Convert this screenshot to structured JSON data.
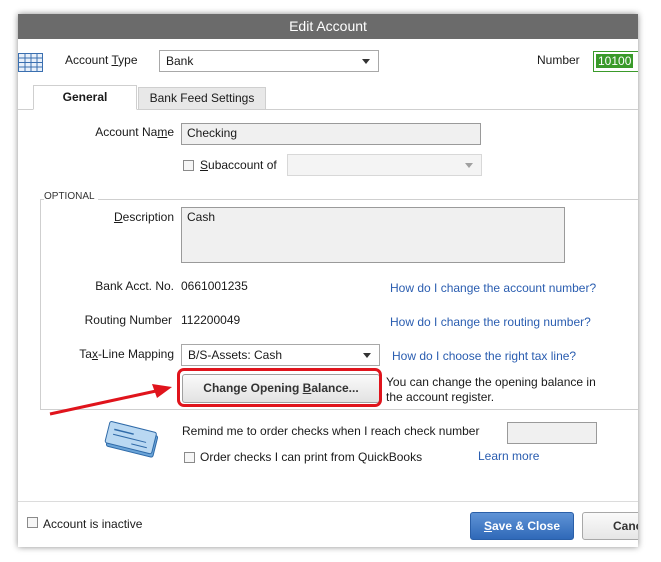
{
  "dialog": {
    "title": "Edit Account"
  },
  "header": {
    "account_type_label_pre": "Account ",
    "account_type_label_u": "T",
    "account_type_label_post": "ype",
    "account_type_value": "Bank",
    "number_label": "Number",
    "number_value": "10100"
  },
  "tabs": [
    {
      "label": "General",
      "selected": true
    },
    {
      "label": "Bank Feed Settings",
      "selected": false
    }
  ],
  "general": {
    "account_name_label_pre": "Account Na",
    "account_name_label_u": "m",
    "account_name_label_post": "e",
    "account_name_value": "Checking",
    "subaccount_label_pre": "",
    "subaccount_label_u": "S",
    "subaccount_label_post": "ubaccount of",
    "subaccount_value": ""
  },
  "optional": {
    "section_label": "OPTIONAL",
    "description_label_pre": "",
    "description_label_u": "D",
    "description_label_post": "escription",
    "description_value": "Cash",
    "bank_acct_label": "Bank Acct. No.",
    "bank_acct_value": "0661001235",
    "bank_acct_link": "How do I change the account number?",
    "routing_label": "Routing Number",
    "routing_value": "112200049",
    "routing_link": "How do I change the routing number?",
    "tax_line_label_pre": "Ta",
    "tax_line_label_u": "x",
    "tax_line_label_post": "-Line Mapping",
    "tax_line_value": "B/S-Assets: Cash",
    "tax_line_link": "How do I choose the right tax line?",
    "change_balance_pre": "Change Opening ",
    "change_balance_u": "B",
    "change_balance_post": "alance...",
    "change_balance_note_line1": "You can change the opening balance in",
    "change_balance_note_line2": "the account register."
  },
  "checks": {
    "remind_label": "Remind me to order checks when I reach check number",
    "remind_value": "",
    "order_label": "Order checks I can print from QuickBooks",
    "learn_more": "Learn more"
  },
  "footer": {
    "inactive_label": "Account is inactive",
    "save_close_pre": "",
    "save_close_u": "S",
    "save_close_post": "ave & Close",
    "cancel_label": "Cancel"
  },
  "colors": {
    "title_bar": "#6b6b6b",
    "number_field": "#3a9a2a",
    "link": "#2a5db0",
    "annotation": "#e0141c",
    "primary_button": "#2f69b8"
  },
  "icons": [
    "ledger-icon",
    "check-order-icon",
    "annotation-arrow-icon"
  ]
}
